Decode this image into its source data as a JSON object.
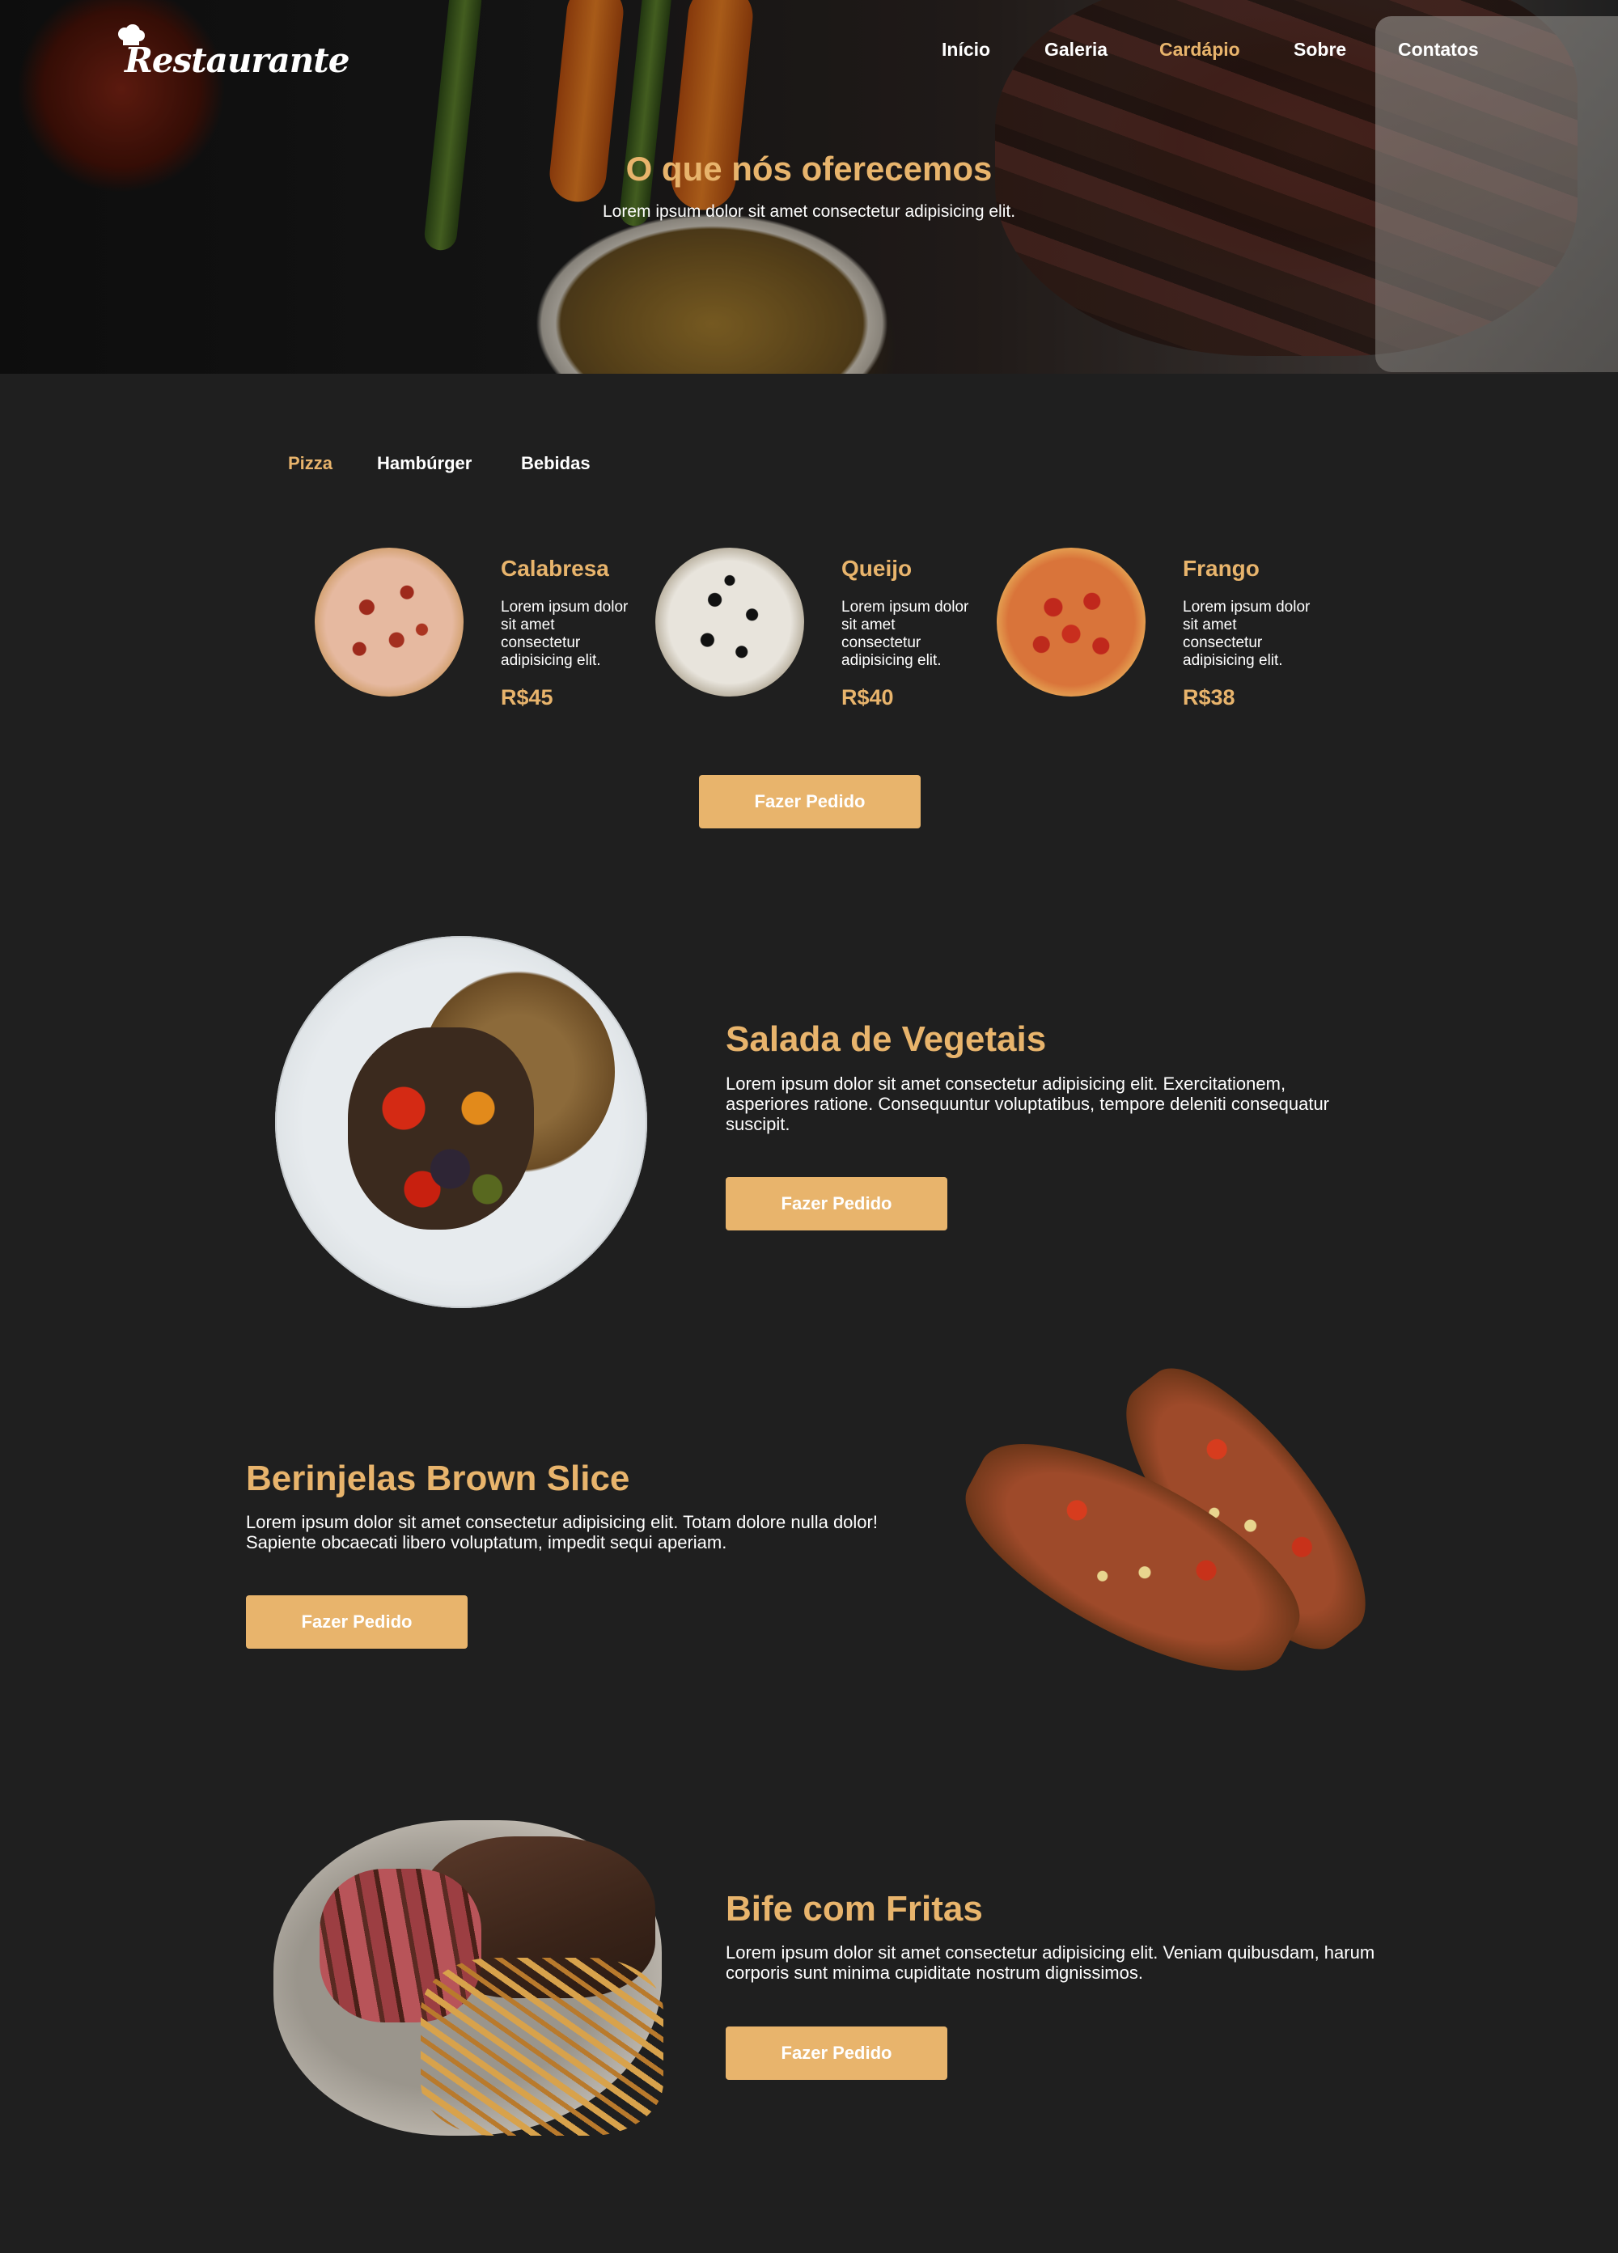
{
  "brand": {
    "logo_text": "Restaurante"
  },
  "nav": {
    "items": [
      {
        "label": "Início"
      },
      {
        "label": "Galeria"
      },
      {
        "label": "Cardápio"
      },
      {
        "label": "Sobre"
      },
      {
        "label": "Contatos"
      }
    ],
    "active": "Cardápio"
  },
  "hero": {
    "title": "O que nós oferecemos",
    "subtitle": "Lorem ipsum dolor sit amet consectetur adipisicing elit."
  },
  "tabs": {
    "items": [
      {
        "label": "Pizza"
      },
      {
        "label": "Hambúrger"
      },
      {
        "label": "Bebidas"
      }
    ],
    "active": "Pizza"
  },
  "menu": {
    "pizzas": [
      {
        "name": "Calabresa",
        "desc": "Lorem ipsum dolor sit amet consectetur adipisicing elit.",
        "price": "R$45"
      },
      {
        "name": "Queijo",
        "desc": "Lorem ipsum dolor sit amet consectetur adipisicing elit.",
        "price": "R$40"
      },
      {
        "name": "Frango",
        "desc": "Lorem ipsum dolor sit amet consectetur adipisicing elit.",
        "price": "R$38"
      }
    ],
    "order_button": "Fazer Pedido"
  },
  "features": [
    {
      "title": "Salada de Vegetais",
      "desc": "Lorem ipsum dolor sit amet consectetur adipisicing elit. Exercitationem, asperiores ratione. Consequuntur voluptatibus, tempore deleniti consequatur suscipit.",
      "button": "Fazer Pedido"
    },
    {
      "title": "Berinjelas Brown Slice",
      "desc": "Lorem ipsum dolor sit amet consectetur adipisicing elit. Totam dolore nulla dolor! Sapiente obcaecati libero voluptatum, impedit sequi aperiam.",
      "button": "Fazer Pedido"
    },
    {
      "title": "Bife com Fritas",
      "desc": "Lorem ipsum dolor sit amet consectetur adipisicing elit. Veniam quibusdam, harum corporis sunt minima cupiditate nostrum dignissimos.",
      "button": "Fazer Pedido"
    }
  ],
  "colors": {
    "accent": "#e8b46c",
    "background": "#1f1f1f",
    "text": "#ffffff"
  }
}
